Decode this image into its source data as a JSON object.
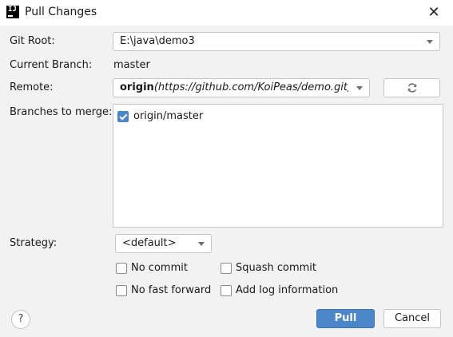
{
  "window": {
    "title": "Pull Changes",
    "icon": "intellij-idea-icon"
  },
  "fields": {
    "git_root": {
      "label": "Git Root:",
      "value": "E:\\java\\demo3"
    },
    "current_branch": {
      "label": "Current Branch:",
      "value": "master"
    },
    "remote": {
      "label": "Remote:",
      "name": "origin",
      "url_display": "(https://github.com/KoiPeas/demo.git)"
    },
    "branches": {
      "label": "Branches to merge:",
      "items": [
        {
          "label": "origin/master",
          "checked": true
        }
      ]
    },
    "strategy": {
      "label": "Strategy:",
      "value": "<default>"
    }
  },
  "options": {
    "no_commit": {
      "label": "No commit",
      "checked": false
    },
    "squash_commit": {
      "label": "Squash commit",
      "checked": false
    },
    "no_fast_forward": {
      "label": "No fast forward",
      "checked": false
    },
    "add_log_information": {
      "label": "Add log information",
      "checked": false
    }
  },
  "buttons": {
    "pull": "Pull",
    "cancel": "Cancel",
    "help": "?"
  },
  "colors": {
    "accent": "#4a86c8",
    "background": "#f2f2f2"
  }
}
